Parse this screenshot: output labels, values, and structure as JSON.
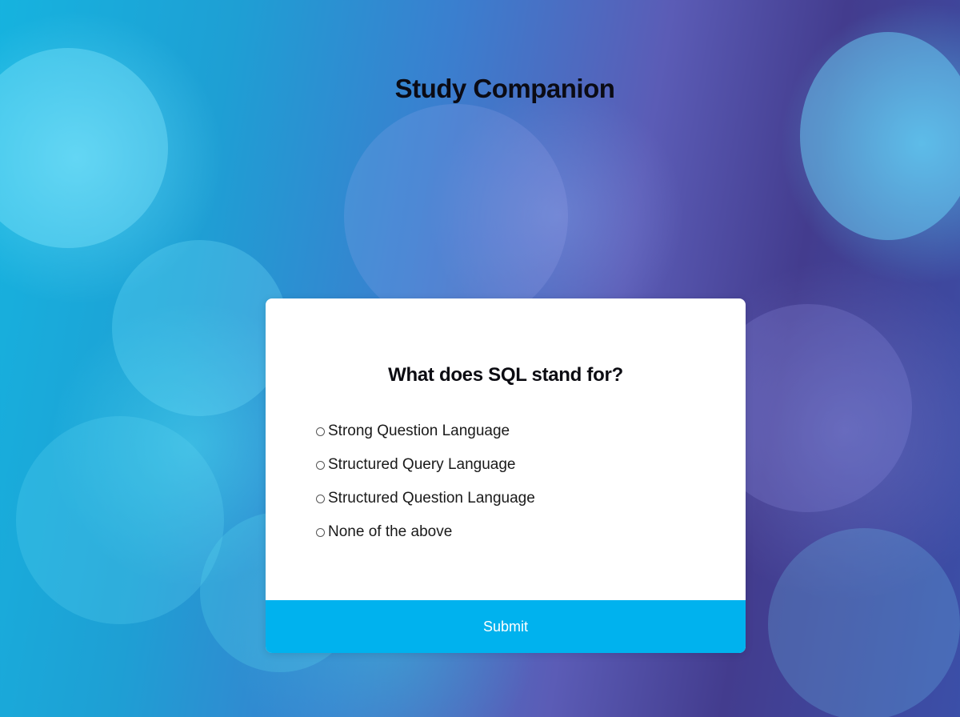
{
  "app": {
    "title": "Study Companion"
  },
  "quiz": {
    "question": "What does SQL stand for?",
    "options": [
      {
        "label": "Strong Question Language",
        "selected": false
      },
      {
        "label": "Structured Query Language",
        "selected": false
      },
      {
        "label": "Structured Question Language",
        "selected": false
      },
      {
        "label": "None of the above",
        "selected": false
      }
    ],
    "submit_label": "Submit"
  },
  "colors": {
    "submit_button": "#00b2ee",
    "card_background": "#ffffff",
    "background_left": "#16b3df",
    "background_right": "#433c8e"
  }
}
